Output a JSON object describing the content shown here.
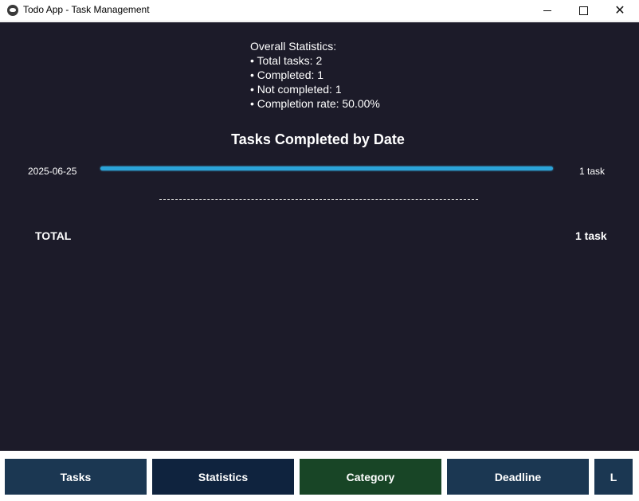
{
  "window": {
    "title": "Todo App - Task Management",
    "controls": [
      "minimize",
      "maximize",
      "close"
    ]
  },
  "statistics": {
    "heading": "Overall Statistics:",
    "lines": [
      "• Total tasks: 2",
      "• Completed: 1",
      "• Not completed: 1",
      "• Completion rate: 50.00%"
    ]
  },
  "chart_data": {
    "type": "bar",
    "title": "Tasks Completed by Date",
    "categories": [
      "2025-06-25"
    ],
    "values": [
      1
    ],
    "value_labels": [
      "1 task"
    ],
    "bar_color": "#2ba3d8"
  },
  "summary": {
    "total_label": "TOTAL",
    "total_value": "1 task"
  },
  "tabs": [
    {
      "label": "Tasks",
      "color": "#1b3752"
    },
    {
      "label": "Statistics",
      "color": "#0f233e"
    },
    {
      "label": "Category",
      "color": "#184526"
    },
    {
      "label": "Deadline",
      "color": "#1b3752"
    },
    {
      "label": "L",
      "color": "#1b3752"
    }
  ],
  "colors": {
    "content_background": "#1c1b29",
    "text": "#ffffff"
  }
}
